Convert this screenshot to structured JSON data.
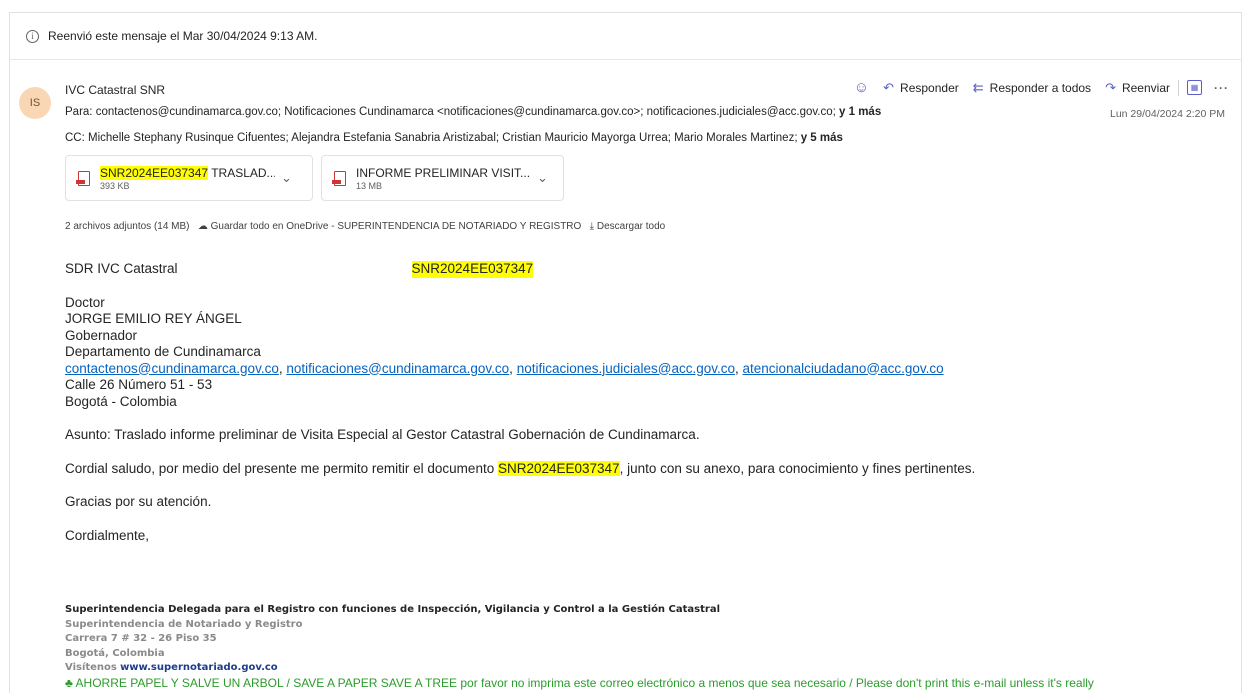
{
  "forward_notice": "Reenvió este mensaje el Mar 30/04/2024 9:13 AM.",
  "sender": {
    "initials": "IS",
    "name": "IVC Catastral SNR",
    "to_label": "Para:",
    "to_list": "contactenos@cundinamarca.gov.co;  Notificaciones Cundinamarca <notificaciones@cundinamarca.gov.co>;  notificaciones.judiciales@acc.gov.co;",
    "to_more": "y 1 más",
    "cc_label": "CC:",
    "cc_list": "Michelle Stephany Rusinque Cifuentes;  Alejandra Estefania Sanabria Aristizabal;  Cristian Mauricio Mayorga Urrea;  Mario Morales Martinez;",
    "cc_more": "y 5 más",
    "date": "Lun 29/04/2024 2:20 PM"
  },
  "actions": {
    "reply": "Responder",
    "reply_all": "Responder a todos",
    "forward": "Reenviar",
    "more": "···"
  },
  "attachments": [
    {
      "name_highlight": "SNR2024EE037347",
      "name_rest": " TRASLAD...",
      "size": "393 KB"
    },
    {
      "name_highlight": "",
      "name_rest": "INFORME PRELIMINAR VISIT...",
      "size": "13 MB"
    }
  ],
  "attachments_summary": {
    "count": "2 archivos adjuntos (14 MB)",
    "save_onedrive": "Guardar todo en OneDrive - SUPERINTENDENCIA DE NOTARIADO Y REGISTRO",
    "download_all": "Descargar todo"
  },
  "body": {
    "dept": "SDR IVC Catastral",
    "code": "SNR2024EE037347",
    "addr_lines": [
      "Doctor",
      "JORGE EMILIO REY ÁNGEL",
      "Gobernador",
      "Departamento de Cundinamarca"
    ],
    "emails": [
      "contactenos@cundinamarca.gov.co",
      "notificaciones@cundinamarca.gov.co",
      "notificaciones.judiciales@acc.gov.co",
      "atencionalciudadano@acc.gov.co"
    ],
    "street": "Calle 26 Número 51 - 53",
    "city": "Bogotá - Colombia",
    "subject": "Asunto: Traslado informe preliminar de Visita Especial al Gestor Catastral Gobernación de Cundinamarca.",
    "greeting_pre": "Cordial saludo, por medio del presente me permito remitir el documento ",
    "greeting_code": "SNR2024EE037347",
    "greeting_post": ", junto con su anexo, para conocimiento y fines pertinentes.",
    "thanks": "Gracias por su atención.",
    "closing": "Cordialmente,"
  },
  "signature": {
    "line1": "Superintendencia Delegada para el Registro con funciones de Inspección, Vigilancia y Control a la Gestión Catastral",
    "line2": "Superintendencia de Notariado y Registro",
    "line3": "Carrera 7 # 32 - 26 Piso 35",
    "line4": "Bogotá, Colombia",
    "visit_label": "Visítenos",
    "website": "www.supernotariado.gov.co",
    "eco_note": "AHORRE PAPEL Y SALVE UN ARBOL / SAVE A PAPER SAVE A TREE por favor no imprima este correo electrónico a menos que sea necesario / Please don't print this e-mail unless it's really"
  },
  "colors": {
    "accent": "#5b5fc7",
    "link": "#0563c1",
    "highlight": "#ffff00",
    "pdf": "#d13438",
    "eco": "#2c9b2c"
  }
}
